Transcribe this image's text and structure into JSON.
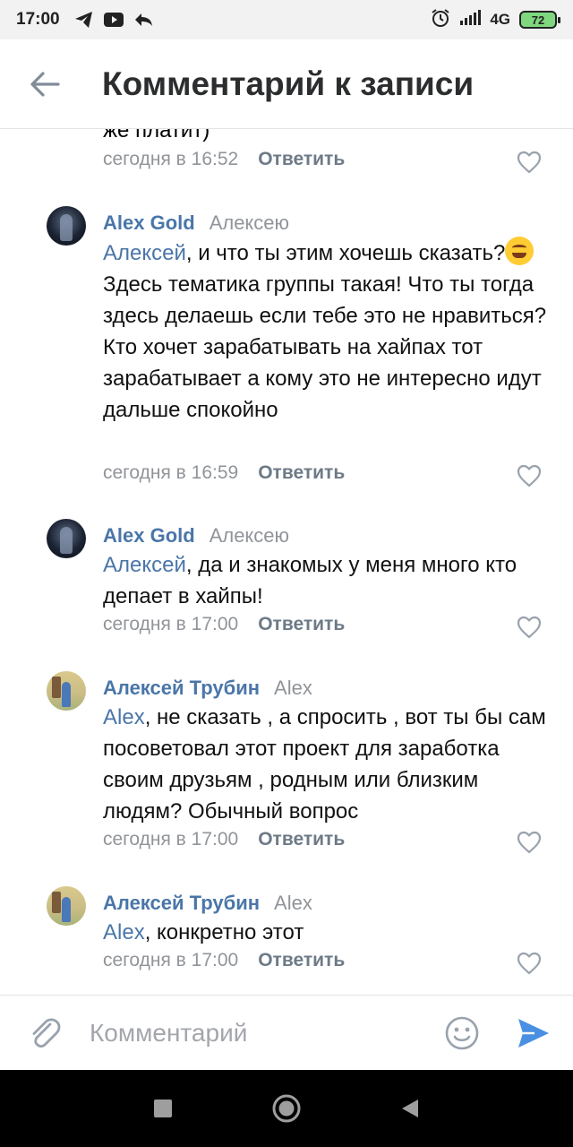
{
  "status_bar": {
    "time": "17:00",
    "network": "4G",
    "battery": "72"
  },
  "header": {
    "title": "Комментарий к записи",
    "back_icon": "arrow-left-icon"
  },
  "feed": {
    "previous_text_cut": "же платит)",
    "previous_meta": {
      "date": "сегодня в 16:52",
      "reply": "Ответить"
    },
    "comments": [
      {
        "author": "Alex Gold",
        "reply_to": "Алексею",
        "mention": "Алексей",
        "text": ", и что ты этим хочешь сказать?",
        "text_after_emoji": " Здесь тематика группы такая! Что ты тогда здесь делаешь если тебе это не нравиться? Кто хочет зарабатывать на хайпах тот зарабатывает а кому это не интересно идут дальше спокойно",
        "date": "сегодня в 16:59",
        "reply": "Ответить"
      },
      {
        "author": "Alex Gold",
        "reply_to": "Алексею",
        "mention": "Алексей",
        "text": ", да и знакомых у меня много кто депает в хайпы!",
        "date": "сегодня в 17:00",
        "reply": "Ответить"
      },
      {
        "author": "Алексей Трубин",
        "reply_to": "Alex",
        "mention": "Alex",
        "text": ", не сказать , а спросить , вот ты бы сам посоветовал этот проект для заработка своим друзьям , родным или близким людям? Обычный вопрос",
        "date": "сегодня в 17:00",
        "reply": "Ответить"
      },
      {
        "author": "Алексей Трубин",
        "reply_to": "Alex",
        "mention": "Alex",
        "text": ", конкретно этот",
        "date": "сегодня в 17:00",
        "reply": "Ответить"
      }
    ]
  },
  "input_bar": {
    "placeholder": "Комментарий",
    "attach_icon": "paperclip-icon",
    "emoji_icon": "smile-icon",
    "send_icon": "send-icon"
  },
  "colors": {
    "link": "#4a76a8",
    "meta": "#919499",
    "send": "#4a90e2"
  }
}
